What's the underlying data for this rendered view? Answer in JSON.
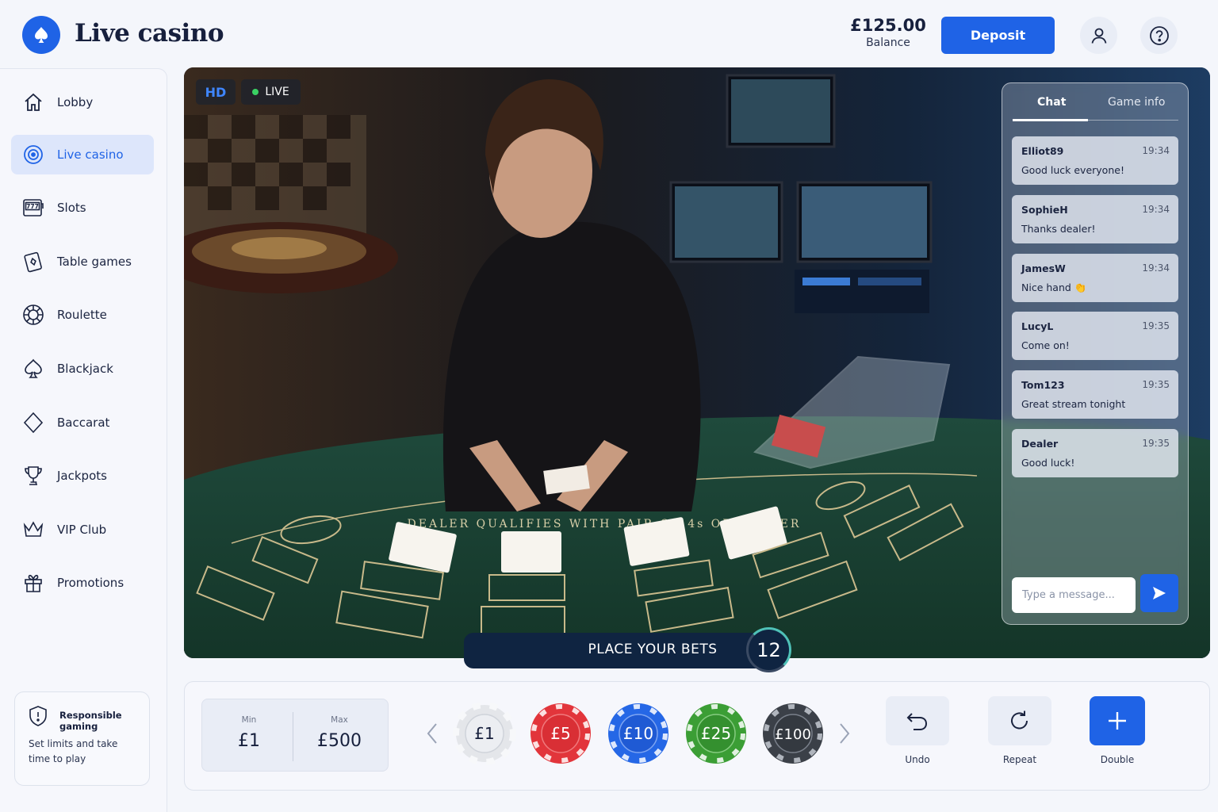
{
  "header": {
    "title": "Live casino",
    "balance_amount": "£125.00",
    "balance_label": "Balance",
    "deposit_label": "Deposit",
    "account_icon": "user-icon",
    "help_icon": "help-icon"
  },
  "sidebar": {
    "items": [
      {
        "label": "Lobby",
        "icon": "home-icon",
        "active": false
      },
      {
        "label": "Live casino",
        "icon": "live-target-icon",
        "active": true
      },
      {
        "label": "Slots",
        "icon": "slot-machine-icon",
        "active": false
      },
      {
        "label": "Table games",
        "icon": "card-icon",
        "active": false
      },
      {
        "label": "Roulette",
        "icon": "roulette-wheel-icon",
        "active": false
      },
      {
        "label": "Blackjack",
        "icon": "spade-icon",
        "active": false
      },
      {
        "label": "Baccarat",
        "icon": "diamond-icon",
        "active": false
      },
      {
        "label": "Jackpots",
        "icon": "trophy-icon",
        "active": false
      },
      {
        "label": "VIP Club",
        "icon": "crown-icon",
        "active": false
      },
      {
        "label": "Promotions",
        "icon": "gift-icon",
        "active": false
      }
    ],
    "responsible": {
      "title": "Responsible gaming",
      "text": "Set limits and take time to play"
    }
  },
  "video": {
    "hd_label": "HD",
    "live_label": "LIVE",
    "table_text": "DEALER QUALIFIES WITH PAIR OF 4s OR BETTER"
  },
  "chat": {
    "tabs": [
      "Chat",
      "Game info"
    ],
    "messages": [
      {
        "user": "Elliot89",
        "time": "19:34",
        "text": "Good luck everyone!"
      },
      {
        "user": "SophieH",
        "time": "19:34",
        "text": "Thanks dealer!"
      },
      {
        "user": "JamesW",
        "time": "19:34",
        "text": "Nice hand 👏"
      },
      {
        "user": "LucyL",
        "time": "19:35",
        "text": "Come on!"
      },
      {
        "user": "Tom123",
        "time": "19:35",
        "text": "Great stream tonight"
      },
      {
        "user": "Dealer",
        "time": "19:35",
        "text": "Good luck!"
      }
    ],
    "input_placeholder": "Type a message...",
    "send_icon": "send-icon"
  },
  "bets": {
    "label": "PLACE YOUR BETS",
    "timer": "12"
  },
  "limits": {
    "min_label": "Min",
    "min_value": "£1",
    "max_label": "Max",
    "max_value": "£500"
  },
  "chips": [
    {
      "label": "£1",
      "color": "#e4e6ea"
    },
    {
      "label": "£5",
      "color": "#e2353b"
    },
    {
      "label": "£10",
      "color": "#2567e6"
    },
    {
      "label": "£25",
      "color": "#3b9e35"
    },
    {
      "label": "£100",
      "color": "#3b4048"
    }
  ],
  "actions": {
    "undo_label": "Undo",
    "repeat_label": "Repeat",
    "double_label": "Double"
  }
}
